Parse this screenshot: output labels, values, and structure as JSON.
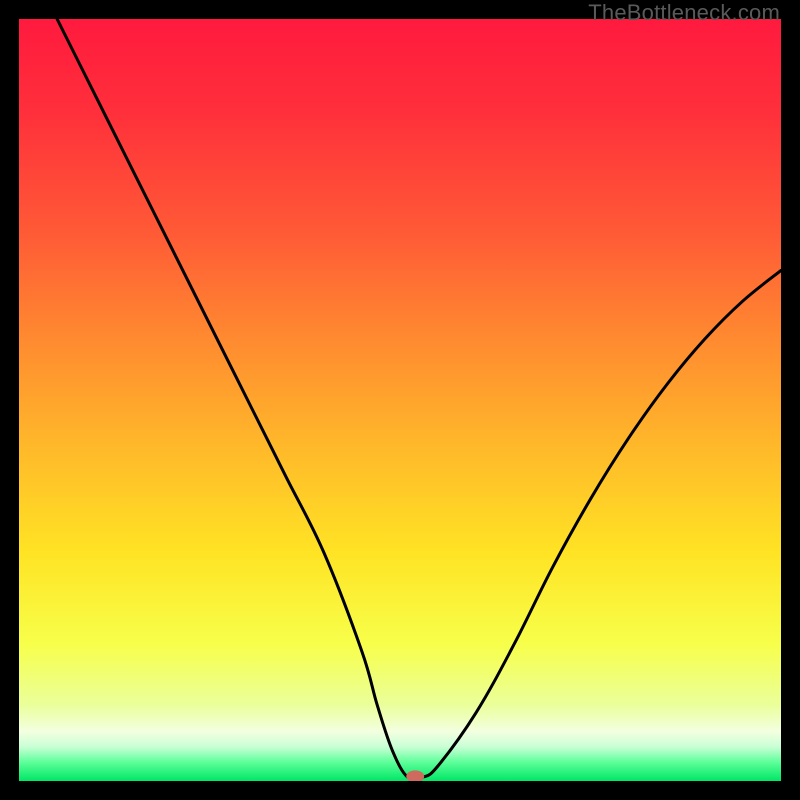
{
  "watermark": "TheBottleneck.com",
  "chart_data": {
    "type": "line",
    "title": "",
    "xlabel": "",
    "ylabel": "",
    "xlim": [
      0,
      100
    ],
    "ylim": [
      0,
      100
    ],
    "grid": false,
    "legend": false,
    "series": [
      {
        "name": "curve",
        "x": [
          5,
          10,
          15,
          20,
          25,
          30,
          35,
          40,
          45,
          47,
          49,
          51,
          53,
          55,
          60,
          65,
          70,
          75,
          80,
          85,
          90,
          95,
          100
        ],
        "y": [
          100,
          90,
          80,
          70,
          60,
          50,
          40,
          30,
          17,
          10,
          4,
          0.5,
          0.5,
          2,
          9,
          18,
          28,
          37,
          45,
          52,
          58,
          63,
          67
        ]
      }
    ],
    "gradient_stops": [
      {
        "offset": 0.0,
        "color": "#ff1a3e"
      },
      {
        "offset": 0.12,
        "color": "#ff2f3b"
      },
      {
        "offset": 0.28,
        "color": "#ff5a36"
      },
      {
        "offset": 0.42,
        "color": "#ff8a30"
      },
      {
        "offset": 0.56,
        "color": "#ffb82a"
      },
      {
        "offset": 0.7,
        "color": "#ffe324"
      },
      {
        "offset": 0.82,
        "color": "#f7ff4a"
      },
      {
        "offset": 0.9,
        "color": "#eaff9a"
      },
      {
        "offset": 0.935,
        "color": "#f3ffe0"
      },
      {
        "offset": 0.955,
        "color": "#c9ffd6"
      },
      {
        "offset": 0.975,
        "color": "#5fff9a"
      },
      {
        "offset": 1.0,
        "color": "#00e765"
      }
    ],
    "marker": {
      "x": 52,
      "y": 0.6,
      "rx": 9,
      "ry": 6,
      "fill": "#cf6a5e"
    }
  }
}
